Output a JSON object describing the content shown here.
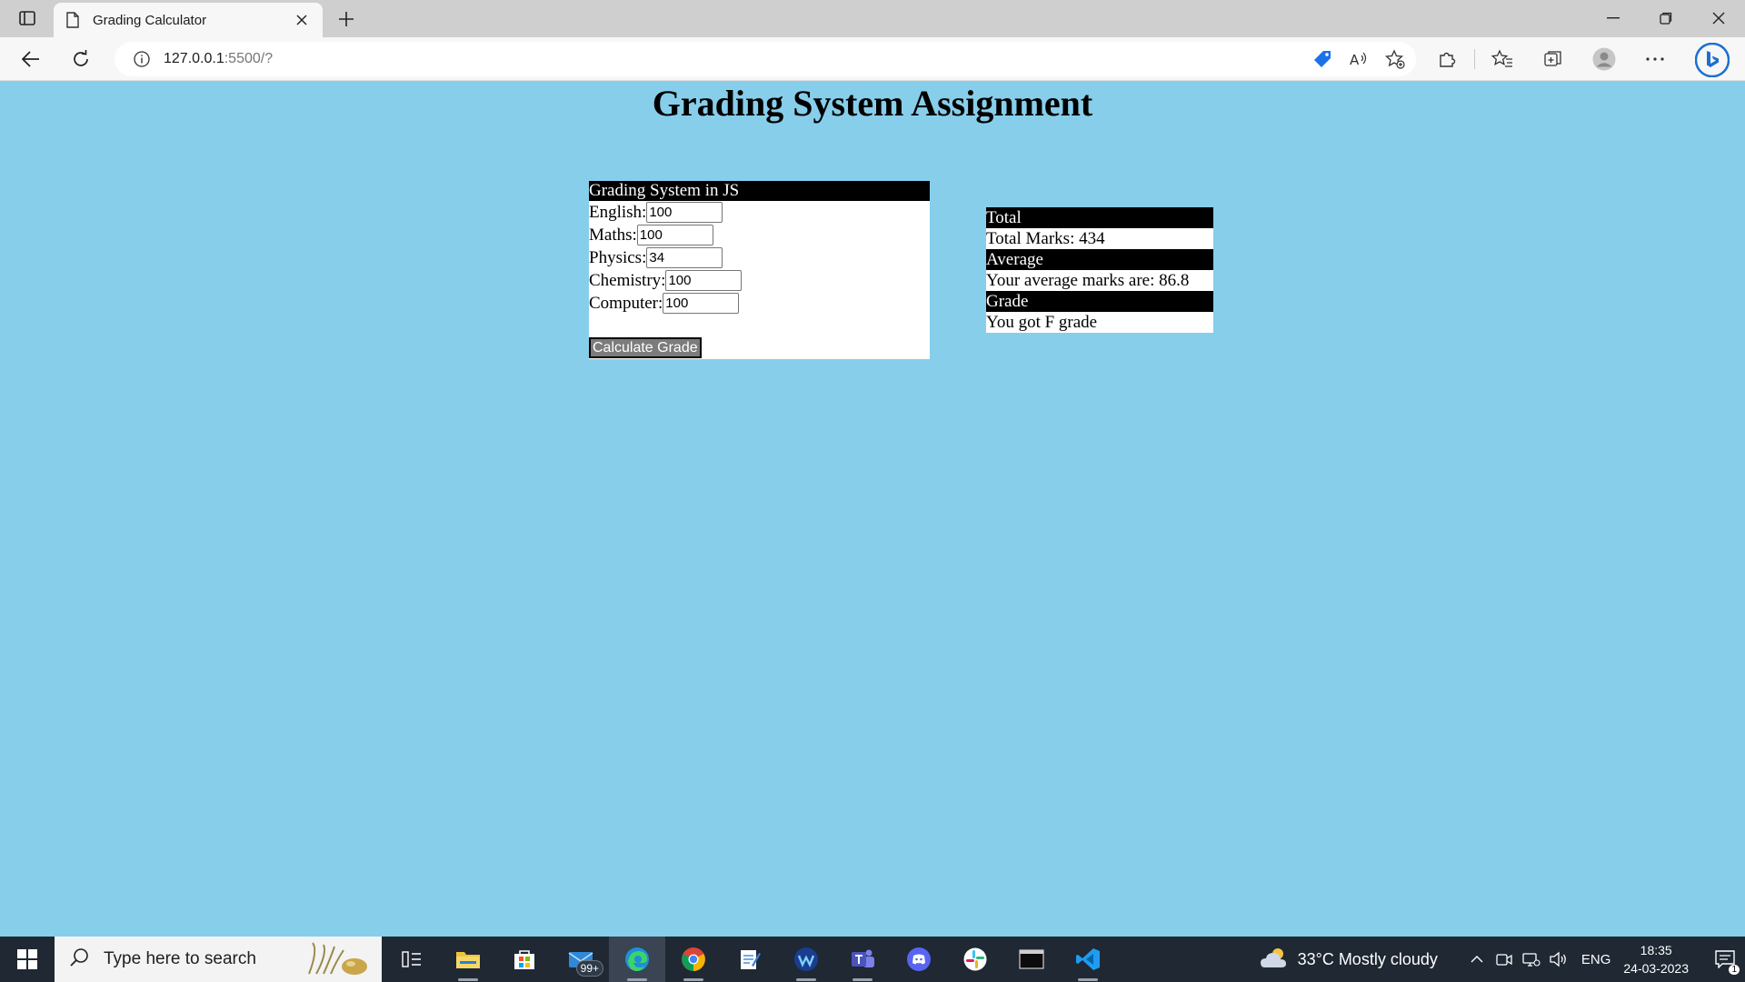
{
  "browser": {
    "tab_title": "Grading Calculator",
    "url_host": "127.0.0.1",
    "url_path": ":5500/?"
  },
  "page": {
    "title": "Grading System Assignment",
    "form": {
      "header": "Grading System in JS",
      "fields": [
        {
          "label": "English:",
          "value": "100"
        },
        {
          "label": "Maths:",
          "value": "100"
        },
        {
          "label": "Physics:",
          "value": "34"
        },
        {
          "label": "Chemistry:",
          "value": "100"
        },
        {
          "label": "Computer:",
          "value": "100"
        }
      ],
      "button_label": "Calculate Grade"
    },
    "results": {
      "total_header": "Total",
      "total_text": "Total Marks: 434",
      "average_header": "Average",
      "average_text": "Your average marks are: 86.8",
      "grade_header": "Grade",
      "grade_text": "You got F grade"
    }
  },
  "taskbar": {
    "search_placeholder": "Type here to search",
    "mail_badge": "99+",
    "weather": "33°C  Mostly cloudy",
    "language": "ENG",
    "time": "18:35",
    "date": "24-03-2023",
    "notification_count": "1"
  },
  "colors": {
    "page_background": "#87ceeb",
    "header_background": "#000000",
    "button_background": "#7c7c7c"
  }
}
